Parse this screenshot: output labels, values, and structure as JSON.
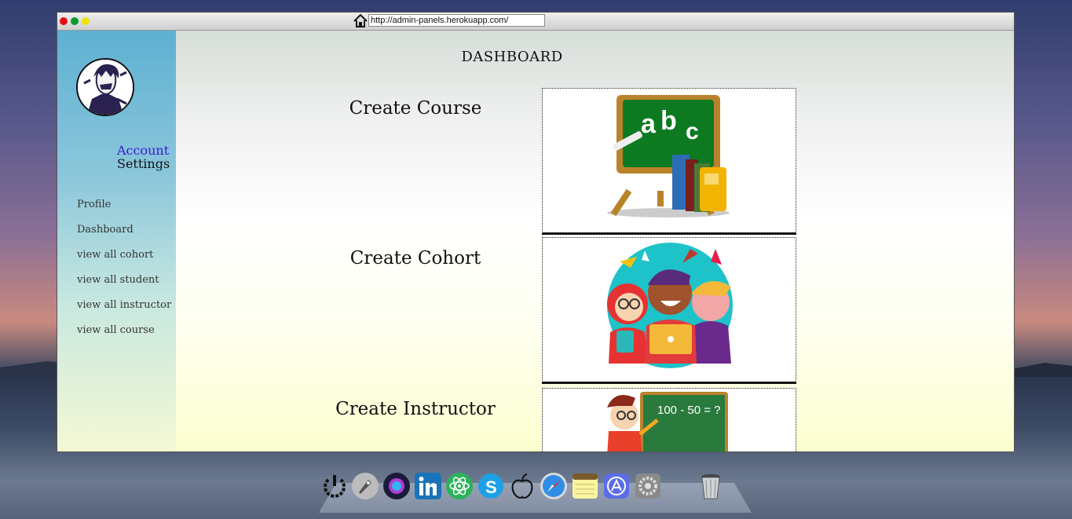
{
  "browser": {
    "url": "http://admin-panels.herokuapp.com/"
  },
  "sidebar": {
    "account_line1": "Account",
    "account_line2": "Settings",
    "items": [
      {
        "label": "Profile"
      },
      {
        "label": "Dashboard"
      },
      {
        "label": "view all cohort"
      },
      {
        "label": "view all student"
      },
      {
        "label": "view all instructor"
      },
      {
        "label": "view all course"
      }
    ]
  },
  "main": {
    "title": "DASHBOARD",
    "cards": [
      {
        "label": "Create Course",
        "image": "chalkboard-abc-icon"
      },
      {
        "label": "Create Cohort",
        "image": "students-group-icon"
      },
      {
        "label": "Create Instructor",
        "image": "teacher-math-board-icon",
        "board_text": "100 - 50 = ?"
      }
    ]
  },
  "dock": {
    "icons": [
      "power-icon",
      "rocket-icon",
      "siri-icon",
      "linkedin-icon",
      "atom-icon",
      "skype-icon",
      "apple-icon",
      "safari-icon",
      "notes-icon",
      "app-store-icon",
      "settings-icon",
      "trash-icon"
    ]
  },
  "colors": {
    "account_accent": "#3b1bd6",
    "sidebar_top": "#5eb0d2",
    "main_bottom": "#fbffcf"
  }
}
